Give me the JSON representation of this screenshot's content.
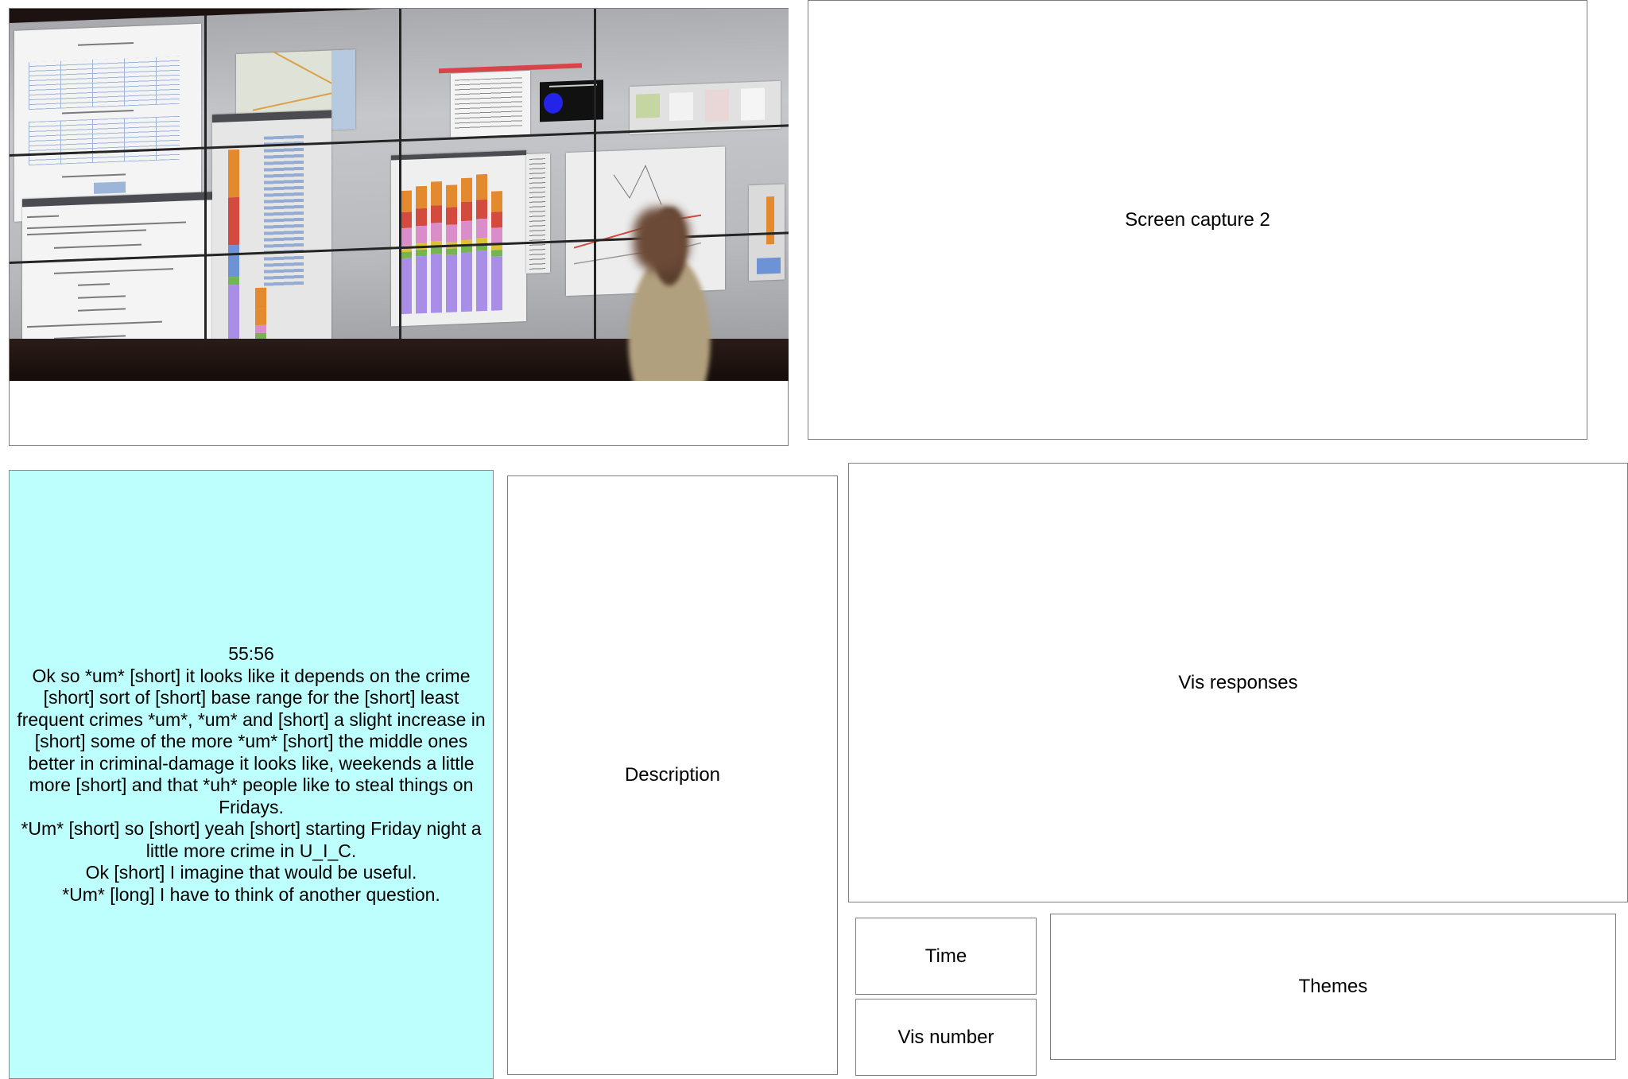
{
  "panels": {
    "screen_capture_2": "Screen capture 2",
    "description": "Description",
    "vis_responses": "Vis responses",
    "time": "Time",
    "vis_number": "Vis number",
    "themes": "Themes"
  },
  "transcript": {
    "timestamp": "55:56",
    "lines": [
      "Ok so *um* [short] it looks like it depends on the crime [short] sort of [short] base range for the [short] least frequent crimes *um*, *um* and [short] a slight increase in [short] some of the more *um* [short] the middle ones better in criminal-damage it looks like, weekends a little more [short] and that *uh* people like to steal things on Fridays.",
      "*Um* [short] so [short] yeah [short] starting Friday night a little more crime in U_I_C.",
      "Ok [short] I imagine that would be useful.",
      "*Um* [long] I have to think of another question."
    ]
  },
  "photo": {
    "colors": {
      "bar_purple": "#a88ee6",
      "bar_green": "#74b54f",
      "bar_yellow": "#d9c438",
      "bar_orange": "#e38a2e",
      "bar_red": "#d24b3e",
      "bar_pink": "#d98ec9",
      "bar_blue": "#6d93d6",
      "panel_bg": "#bdfffd"
    }
  }
}
